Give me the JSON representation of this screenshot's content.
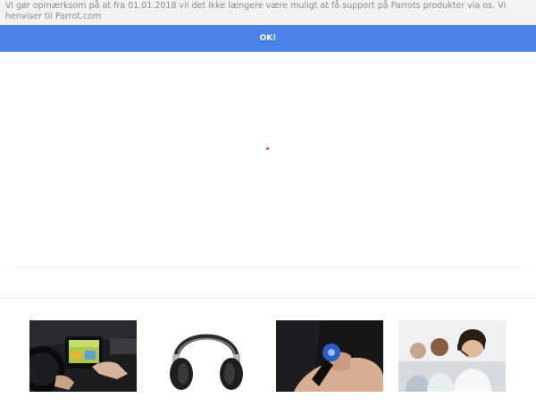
{
  "notice": {
    "text": "Vi gør opmærksom på at fra 01.01.2018 vil det ikke længere være muligt at få support på Parrots produkter via os. Vi henviser til Parrot.com",
    "ok_label": "OK!",
    "ok_color": "#4a82e6"
  },
  "loader": {
    "accent": "#e2452a"
  },
  "products": [
    {
      "image": "car-dashboard-touchscreen",
      "caption": ""
    },
    {
      "image": "headphones",
      "caption": ""
    },
    {
      "image": "hand-holding-car-kit-remote",
      "caption": ""
    },
    {
      "image": "support-agents-headset",
      "caption": ""
    }
  ]
}
